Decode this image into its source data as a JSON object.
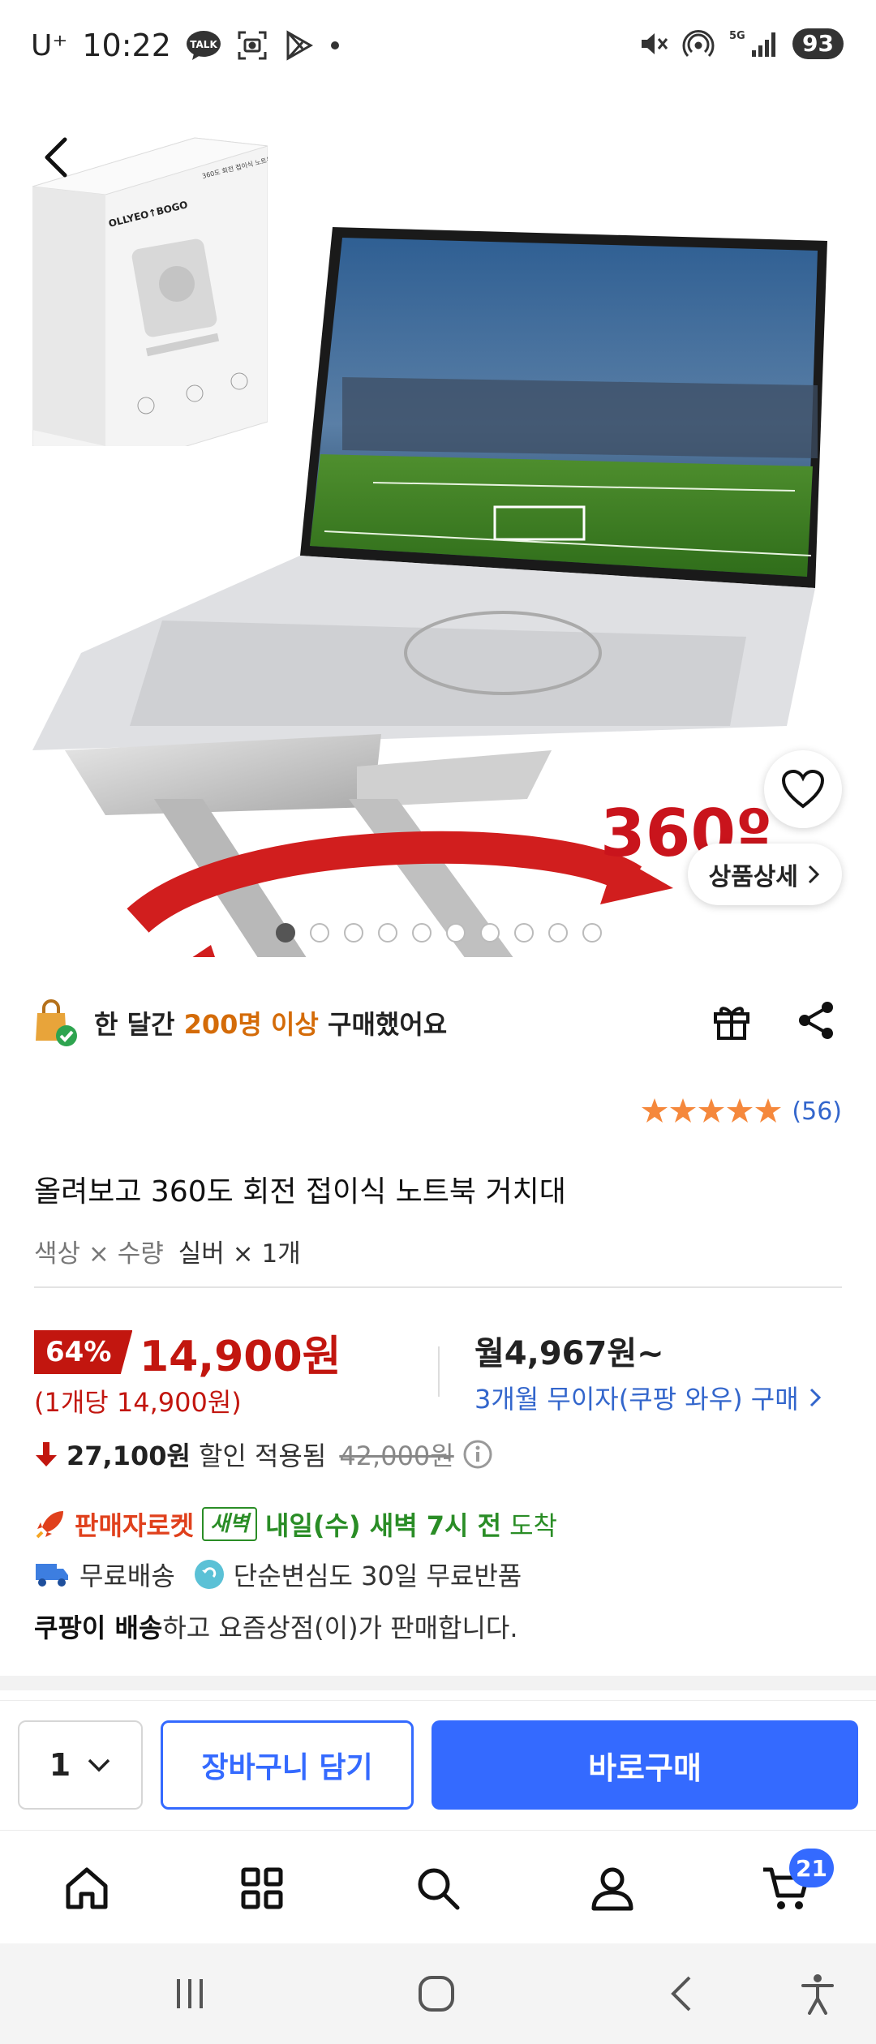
{
  "status_bar": {
    "carrier": "U⁺",
    "time": "10:22",
    "talk_badge": "TALK",
    "network": "5G",
    "battery": "93"
  },
  "product_gallery": {
    "box_brand": "OLLYEO↑BOGO",
    "box_caption": "360도 회전 접이식 노트북 거치대",
    "rotation_label": "360º",
    "detail_button": "상품상세",
    "slide_count": 10,
    "active_slide": 1
  },
  "purchase_info": {
    "prefix": "한 달간 ",
    "highlight": "200명 이상",
    "suffix": " 구매했어요"
  },
  "rating": {
    "stars": 5,
    "count": "(56)"
  },
  "product": {
    "title": "올려보고 360도 회전 접이식 노트북 거치대",
    "option_label": "색상 × 수량",
    "option_value": "실버 × 1개"
  },
  "price": {
    "discount_rate": "64%",
    "sale_price": "14,900원",
    "unit_price": "(1개당 14,900원)",
    "monthly": "월4,967원~",
    "installment": "3개월 무이자(쿠팡 와우) 구매",
    "savings_amount": "27,100원",
    "savings_label": "할인 적용됨",
    "original_price": "42,000원"
  },
  "delivery": {
    "rocket_label": "판매자로켓",
    "dawn_badge": "새벽",
    "arrival": "내일(수) 새벽 7시 전",
    "arrival_suffix": " 도착",
    "free_shipping": "무료배송",
    "free_return": "단순변심도 30일 무료반품",
    "seller_bold": "쿠팡이 배송",
    "seller_rest": "하고 요즘상점(이)가 판매합니다."
  },
  "action_bar": {
    "quantity": "1",
    "cart_button": "장바구니 담기",
    "buy_button": "바로구매"
  },
  "tab_bar": {
    "cart_count": "21",
    "items": [
      "home-icon",
      "category-icon",
      "search-icon",
      "profile-icon",
      "cart-icon"
    ]
  },
  "colors": {
    "accent_blue": "#346aff",
    "price_red": "#c2160f",
    "rocket_orange": "#e0401c",
    "delivery_green": "#2a8d26",
    "highlight_orange": "#d46b08",
    "star": "#f5883c"
  }
}
